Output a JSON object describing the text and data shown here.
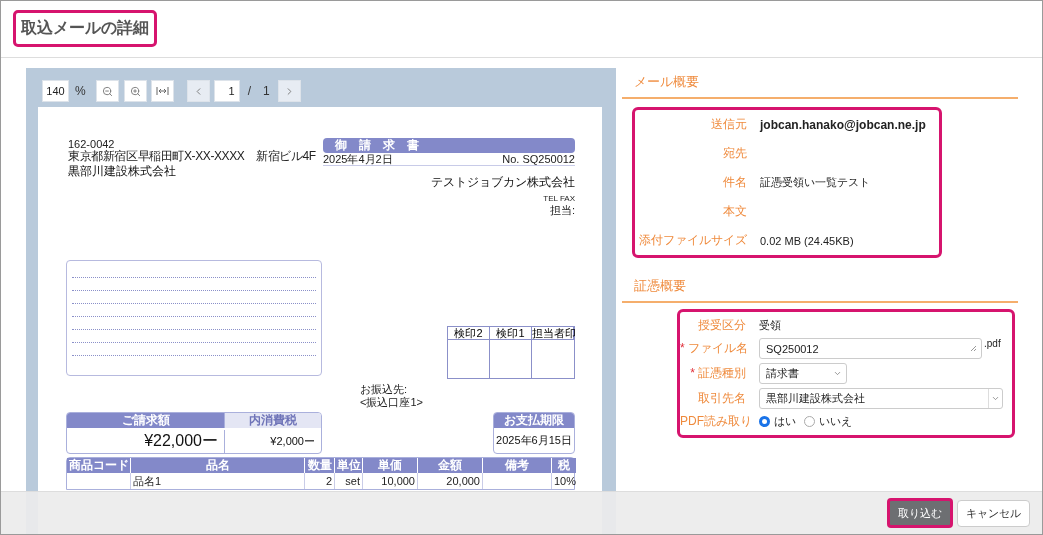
{
  "window": {
    "title": "取込メールの詳細"
  },
  "pdf_viewer": {
    "zoom": "140",
    "zoom_unit": "%",
    "page": "1",
    "page_separator": "/",
    "page_total": "1"
  },
  "invoice": {
    "postcode": "162-0042",
    "address": "東京都新宿区早稲田町X-XX-XXXX　新宿ビル4F",
    "customer": "黒部川建設株式会社",
    "title": "御請求書",
    "date": "2025年4月2日",
    "number": "No. SQ250012",
    "issuer": "テストジョブカン株式会社",
    "contact": "TEL FAX",
    "person": "担当:",
    "stamps": [
      "検印2",
      "検印1",
      "担当者印"
    ],
    "transfer_label": "お振込先:",
    "transfer_account": "<振込口座1>",
    "total_label": "ご請求額",
    "total": "¥22,000ー",
    "tax_label": "内消費税",
    "tax": "¥2,000ー",
    "due_label": "お支払期限",
    "due": "2025年6月15日",
    "items": {
      "columns": [
        "商品コード",
        "品名",
        "数量",
        "単位",
        "単価",
        "金額",
        "備考",
        "税"
      ],
      "rows": [
        {
          "cells": [
            null,
            "品名1",
            "2",
            "set",
            "10,000",
            "20,000",
            null,
            "10%"
          ]
        }
      ]
    }
  },
  "mail_summary": {
    "heading": "メール概要",
    "fields": [
      {
        "label": "送信元",
        "value": "jobcan.hanako@jobcan.ne.jp",
        "emphasis": true
      },
      {
        "label": "宛先"
      },
      {
        "label": "件名",
        "value": "証憑受領い一覧テスト"
      },
      {
        "label": "本文"
      },
      {
        "label": "添付ファイルサイズ",
        "value": "0.02 MB (24.45KB)"
      }
    ]
  },
  "voucher_summary": {
    "heading": "証憑概要",
    "fields": [
      {
        "kind": "text",
        "label": "授受区分",
        "value": "受領"
      },
      {
        "kind": "input",
        "label": "ファイル名",
        "marker": "*",
        "value": "SQ250012",
        "suffix": ".pdf"
      },
      {
        "kind": "select",
        "label": "証憑種別",
        "marker": "*",
        "value": "請求書"
      },
      {
        "kind": "combo",
        "label": "取引先名",
        "value": "黒部川建設株式会社"
      },
      {
        "kind": "radio",
        "label": "PDF読み取り",
        "options": [
          {
            "label": "はい",
            "selected": true
          },
          {
            "label": "いいえ",
            "selected": false
          }
        ]
      }
    ]
  },
  "buttons": [
    {
      "label": "取り込む",
      "kind": "primary"
    },
    {
      "label": "キャンセル",
      "kind": "secondary"
    }
  ]
}
